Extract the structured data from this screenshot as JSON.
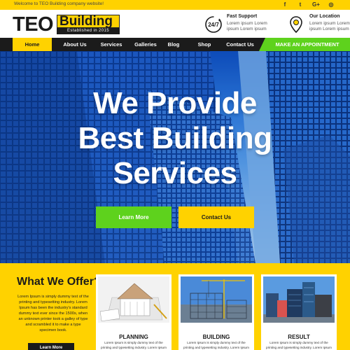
{
  "topbar": {
    "welcome": "Welcome to TEO Building company website!",
    "social": [
      {
        "icon": "facebook-icon",
        "glyph": "f"
      },
      {
        "icon": "twitter-icon",
        "glyph": "t"
      },
      {
        "icon": "google-plus-icon",
        "glyph": "G+"
      },
      {
        "icon": "instagram-icon",
        "glyph": "◎"
      }
    ]
  },
  "logo": {
    "teo": "TEO",
    "building": "Building",
    "established": "Established in 2015"
  },
  "support": {
    "icon": "24-7-icon",
    "badge": "24/7",
    "title": "Fast Support",
    "line1": "Lorem ipsum Lorem",
    "line2": "ipsum Lorem ipsum"
  },
  "location": {
    "icon": "map-pin-icon",
    "title": "Our Location",
    "line1": "Lorem ipsum Lorem",
    "line2": "ipsum Lorem ipsum"
  },
  "nav": {
    "items": [
      "Home",
      "About Us",
      "Services",
      "Galleries",
      "Blog",
      "Shop",
      "Contact Us"
    ],
    "active": "Home",
    "cta": "MAKE AN APPOINTMENT"
  },
  "hero": {
    "line1": "We Provide",
    "line2": "Best Building",
    "line3": "Services",
    "learn_more": "Learn More",
    "contact_us": "Contact Us"
  },
  "offer": {
    "heading": "What We Offer?",
    "description": "Lorem Ipsum is simply dummy text of the printing and typesetting industry. Lorem Ipsum has been the industry's standard dummy text ever since the 1500s, when an unknown printer took a galley of type and scrambled it to make a type specimen book.",
    "learn_more": "Learn More",
    "cards": [
      {
        "title": "PLANNING",
        "text": "Lorem Ipsum is simply dummy text of the printing and typesetting industry. Lorem Ipsum has been the industry's standard dummy text ever since the 1500s, when an unknown printer took a galley of type and scrambled it to"
      },
      {
        "title": "BUILDING",
        "text": "Lorem Ipsum is simply dummy text of the printing and typesetting industry. Lorem Ipsum has been the industry's standard dummy text ever since the 1500s, when an unknown printer took a galley of type and scrambled it to"
      },
      {
        "title": "RESULT",
        "text": "Lorem Ipsum is simply dummy text of the printing and typesetting industry. Lorem Ipsum has been the industry's standard dummy text ever since the 1500s, when an unknown printer took a galley of type and scrambled it to"
      }
    ]
  },
  "colors": {
    "accent_yellow": "#ffd200",
    "accent_green": "#5ed21d",
    "dark": "#1b1b1b",
    "sky_blue": "#2f7de0"
  }
}
